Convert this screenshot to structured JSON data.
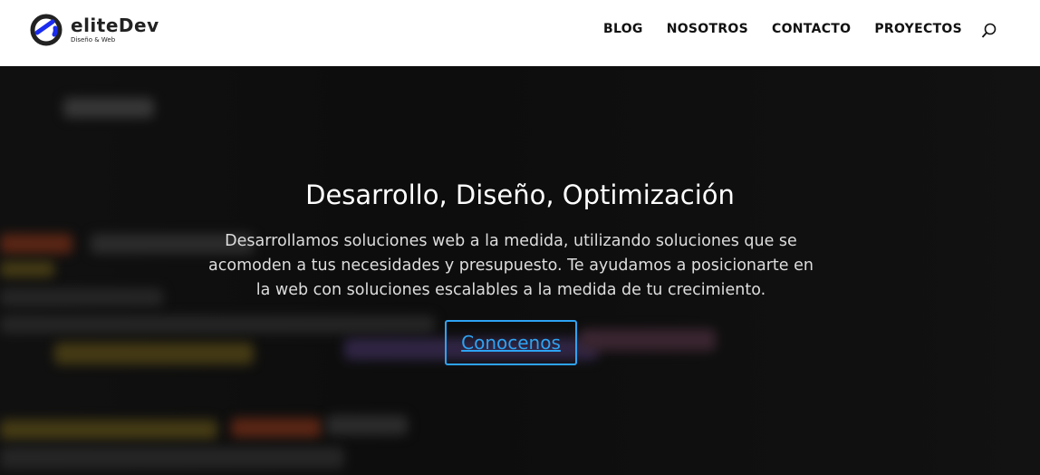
{
  "header": {
    "logo_name": "eliteDev",
    "logo_sub": "Diseño & Web",
    "nav": [
      "BLOG",
      "NOSOTROS",
      "CONTACTO",
      "PROYECTOS"
    ]
  },
  "hero": {
    "title": "Desarrollo, Diseño, Optimización",
    "description": "Desarrollamos soluciones web a la medida, utilizando soluciones que se acomoden a tus necesidades y presupuesto. Te ayudamos a posicionarte en la web con soluciones escalables a la medida de tu crecimiento.",
    "button": "Conocenos"
  },
  "colors": {
    "accent": "#2ea3f2",
    "logo_blue": "#1a2cf0"
  }
}
